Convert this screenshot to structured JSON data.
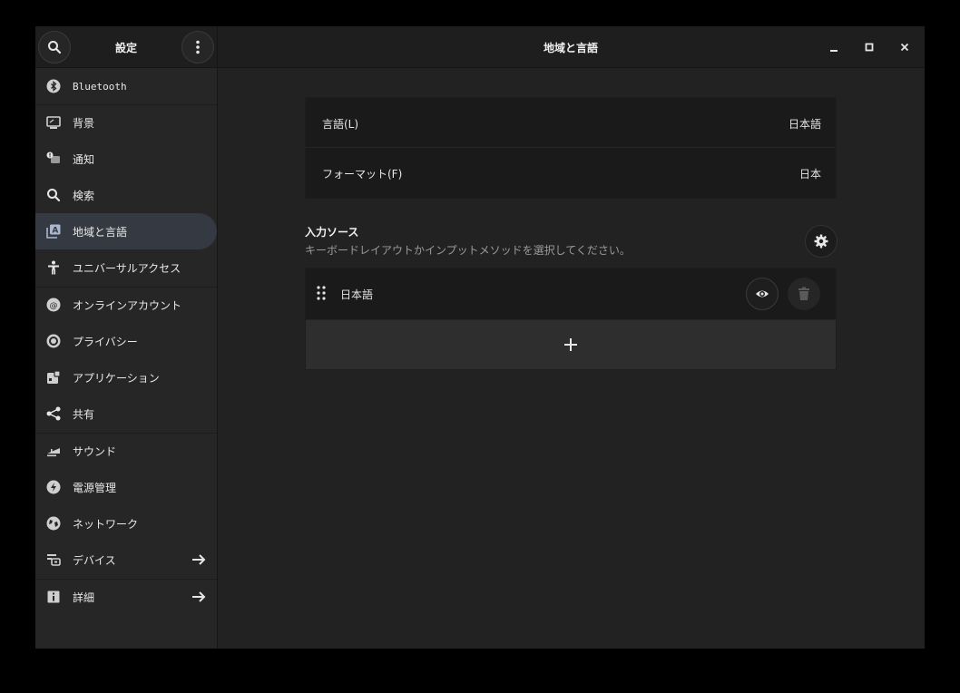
{
  "header": {
    "sidebar_title": "設定",
    "page_title": "地域と言語"
  },
  "sidebar": {
    "items": [
      {
        "label": "Bluetooth",
        "icon": "bluetooth-icon"
      },
      {
        "label": "背景",
        "icon": "background-icon"
      },
      {
        "label": "通知",
        "icon": "notifications-icon"
      },
      {
        "label": "検索",
        "icon": "search-icon"
      },
      {
        "label": "地域と言語",
        "icon": "region-language-icon",
        "active": true
      },
      {
        "label": "ユニバーサルアクセス",
        "icon": "accessibility-icon"
      },
      {
        "label": "オンラインアカウント",
        "icon": "online-accounts-icon"
      },
      {
        "label": "プライバシー",
        "icon": "privacy-icon"
      },
      {
        "label": "アプリケーション",
        "icon": "applications-icon"
      },
      {
        "label": "共有",
        "icon": "share-icon"
      },
      {
        "label": "サウンド",
        "icon": "sound-icon"
      },
      {
        "label": "電源管理",
        "icon": "power-icon"
      },
      {
        "label": "ネットワーク",
        "icon": "network-icon"
      },
      {
        "label": "デバイス",
        "icon": "devices-icon",
        "arrow": true
      },
      {
        "label": "詳細",
        "icon": "details-icon",
        "arrow": true
      }
    ]
  },
  "language_settings": {
    "rows": [
      {
        "label": "言語(L)",
        "value": "日本語"
      },
      {
        "label": "フォーマット(F)",
        "value": "日本"
      }
    ]
  },
  "input_sources": {
    "title": "入力ソース",
    "subtitle": "キーボードレイアウトかインプットメソッドを選択してください。",
    "sources": [
      {
        "label": "日本語"
      }
    ]
  },
  "colors": {
    "window_bg": "#222222",
    "sidebar_bg": "#262626",
    "active_item_bg": "#353a42",
    "list_bg": "#1a1a1a",
    "add_row_bg": "#2e2e2e"
  }
}
